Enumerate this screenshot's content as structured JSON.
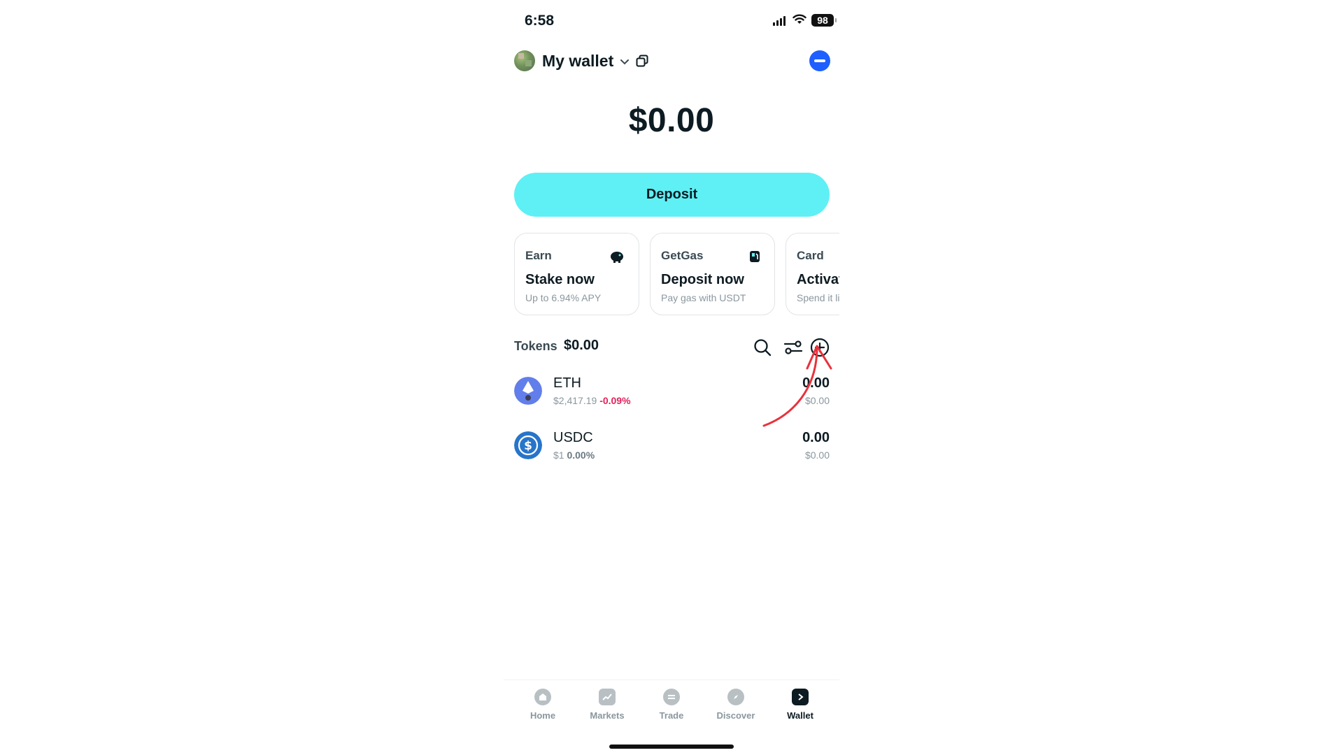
{
  "status_bar": {
    "time": "6:58",
    "battery": "98"
  },
  "header": {
    "wallet_name": "My wallet"
  },
  "balance": {
    "total": "$0.00"
  },
  "deposit": {
    "label": "Deposit"
  },
  "cards": [
    {
      "tag": "Earn",
      "title": "Stake now",
      "subtitle": "Up to 6.94% APY",
      "icon": "piggy-bank-icon"
    },
    {
      "tag": "GetGas",
      "title": "Deposit now",
      "subtitle": "Pay gas with USDT",
      "icon": "gas-pump-icon"
    },
    {
      "tag": "Card",
      "title": "Activate",
      "subtitle": "Spend it like"
    }
  ],
  "tokens": {
    "label": "Tokens",
    "total": "$0.00",
    "items": [
      {
        "symbol": "ETH",
        "price": "$2,417.19",
        "change": "-0.09%",
        "amount": "0.00",
        "value": "$0.00",
        "color": "#627eea"
      },
      {
        "symbol": "USDC",
        "price": "$1",
        "change": "0.00%",
        "amount": "0.00",
        "value": "$0.00",
        "color": "#2775ca"
      }
    ]
  },
  "nav": {
    "items": [
      {
        "label": "Home",
        "icon": "home-icon"
      },
      {
        "label": "Markets",
        "icon": "chart-icon"
      },
      {
        "label": "Trade",
        "icon": "trade-icon"
      },
      {
        "label": "Discover",
        "icon": "compass-icon"
      },
      {
        "label": "Wallet",
        "icon": "wallet-icon",
        "active": true
      }
    ]
  },
  "colors": {
    "accent": "#5ef0f5",
    "negative": "#e0245e",
    "badge": "#1f5fff",
    "annotation": "#e8323c"
  }
}
